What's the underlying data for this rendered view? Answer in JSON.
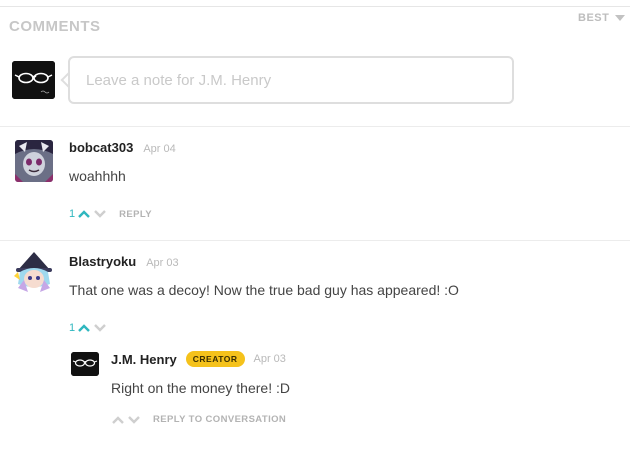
{
  "header": {
    "title": "COMMENTS",
    "sort_label": "BEST"
  },
  "compose": {
    "placeholder": "Leave a note for J.M. Henry"
  },
  "comments": [
    {
      "username": "bobcat303",
      "date": "Apr 04",
      "text": "woahhhh",
      "vote_count": "1",
      "reply_label": "REPLY"
    },
    {
      "username": "Blastryoku",
      "date": "Apr 03",
      "text": "That one was a decoy! Now the true bad guy has appeared! :O",
      "vote_count": "1",
      "reply_label": ""
    }
  ],
  "reply": {
    "username": "J.M. Henry",
    "badge": "CREATOR",
    "date": "Apr 03",
    "text": "Right on the money there! :D",
    "reply_label": "REPLY TO CONVERSATION"
  },
  "colors": {
    "accent": "#2fb7bf",
    "badge": "#f5c21b"
  }
}
